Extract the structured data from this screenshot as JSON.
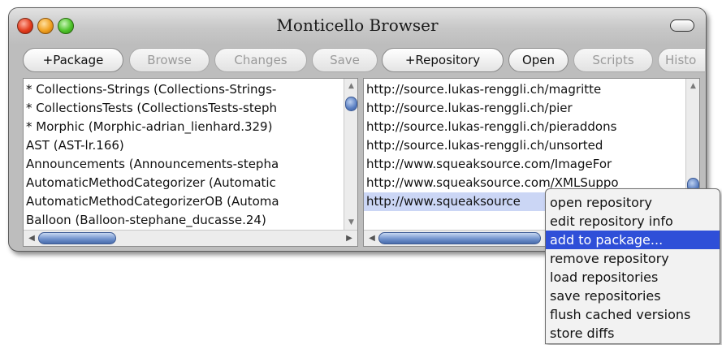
{
  "window": {
    "title": "Monticello Browser"
  },
  "toolbar": {
    "buttons": [
      {
        "label": "+Package",
        "enabled": true
      },
      {
        "label": "Browse",
        "enabled": false
      },
      {
        "label": "Changes",
        "enabled": false
      },
      {
        "label": "Save",
        "enabled": false
      },
      {
        "label": "+Repository",
        "enabled": true
      },
      {
        "label": "Open",
        "enabled": true
      },
      {
        "label": "Scripts",
        "enabled": false
      },
      {
        "label": "Histo",
        "enabled": false
      }
    ]
  },
  "packages": {
    "items": [
      "* Collections-Strings (Collections-Strings-",
      "* CollectionsTests (CollectionsTests-steph",
      "* Morphic (Morphic-adrian_lienhard.329)",
      "AST (AST-lr.166)",
      "Announcements (Announcements-stepha",
      "AutomaticMethodCategorizer (Automatic",
      "AutomaticMethodCategorizerOB (Automa",
      "Balloon (Balloon-stephane_ducasse.24)"
    ]
  },
  "repositories": {
    "items": [
      "http://source.lukas-renggli.ch/magritte",
      "http://source.lukas-renggli.ch/pier",
      "http://source.lukas-renggli.ch/pieraddons",
      "http://source.lukas-renggli.ch/unsorted",
      "http://www.squeaksource.com/ImageFor",
      "http://www.squeaksource.com/XMLSuppo",
      "http://www.squeaksource"
    ],
    "selected_index": 6
  },
  "context_menu": {
    "items": [
      "open repository",
      "edit repository info",
      "add to package...",
      "remove repository",
      "load repositories",
      "save repositories",
      "flush cached versions",
      "store diffs"
    ],
    "highlighted_index": 2
  },
  "colors": {
    "selection": "#cbd6f5",
    "menu_highlight": "#2f4fd8",
    "window_bg": "#bdbdbd"
  }
}
